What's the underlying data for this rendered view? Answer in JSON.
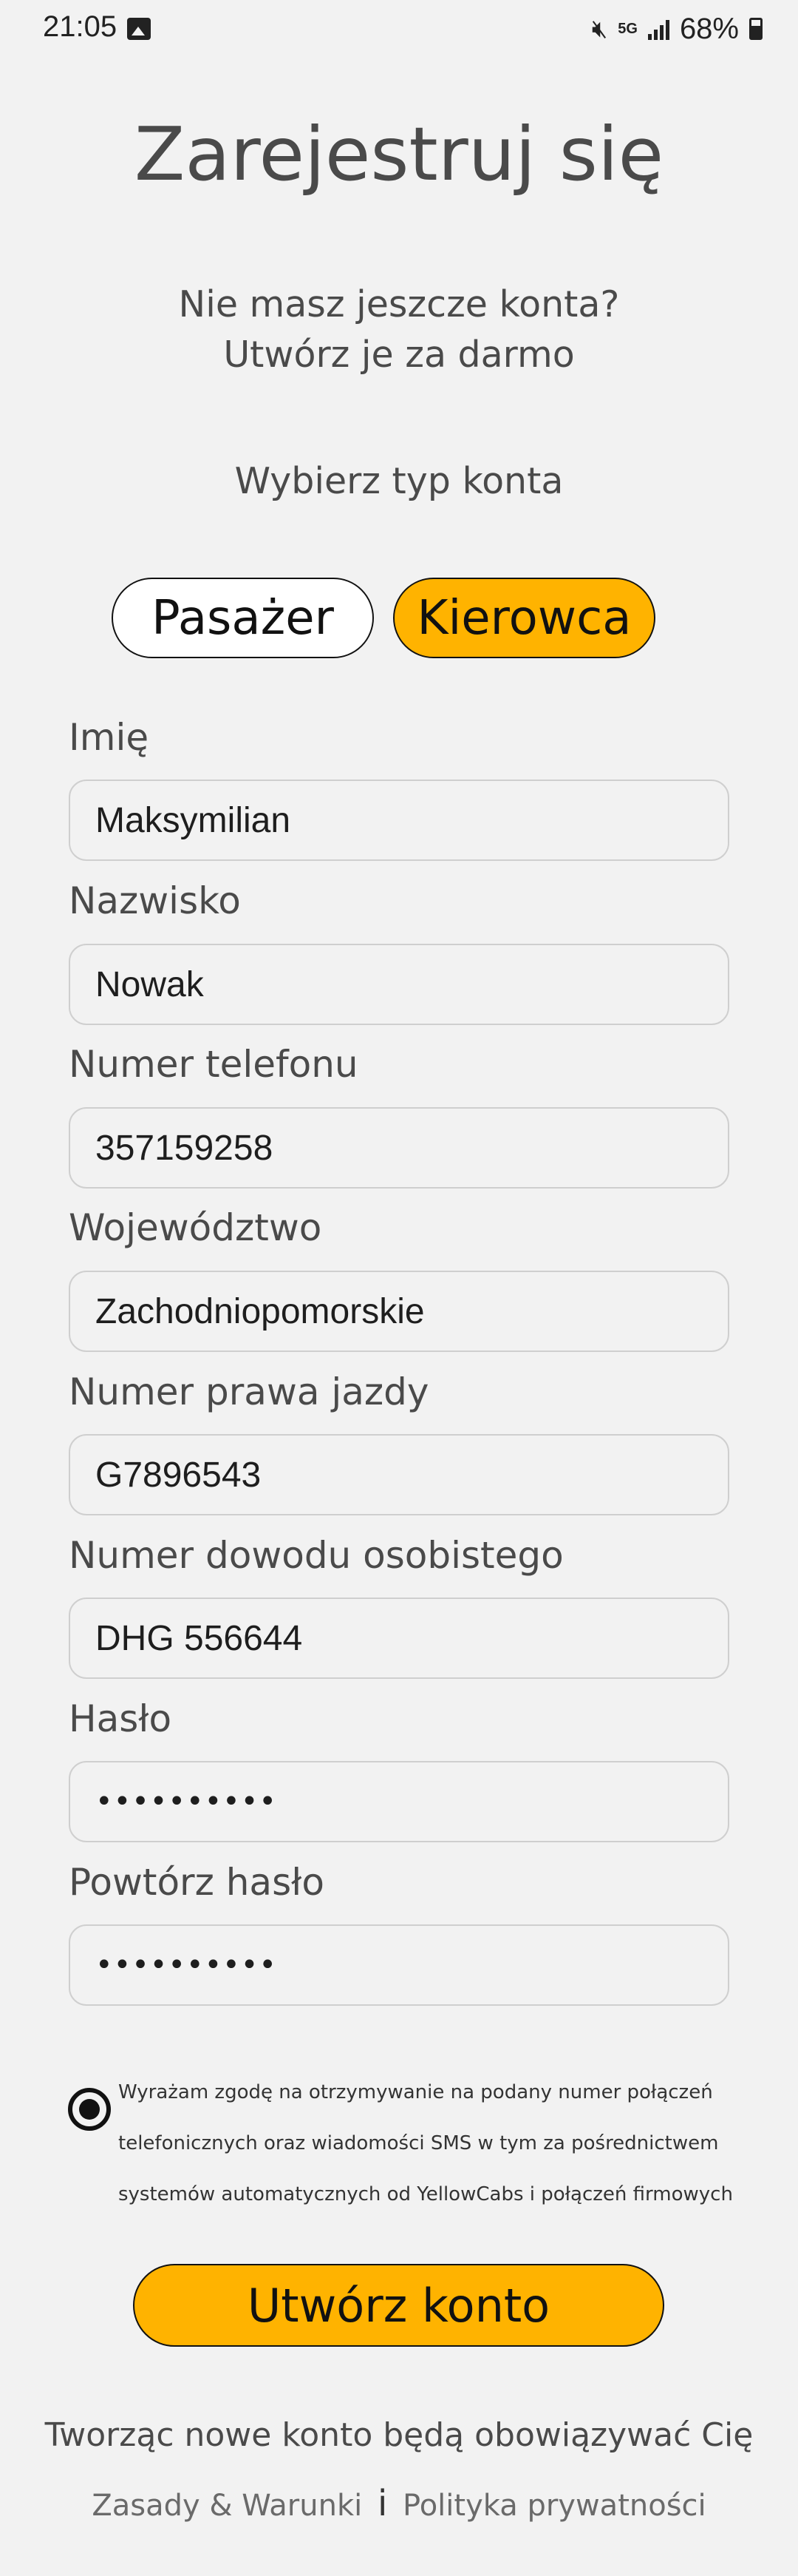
{
  "status_bar": {
    "time": "21:05",
    "network": "5G",
    "battery": "68%"
  },
  "header": {
    "title": "Zarejestruj się",
    "subtitle_line1": "Nie masz jeszcze konta?",
    "subtitle_line2": "Utwórz je za darmo",
    "choose_type": "Wybierz typ konta"
  },
  "account_types": {
    "passenger": "Pasażer",
    "driver": "Kierowca",
    "selected": "Kierowca"
  },
  "form": {
    "first_name": {
      "label": "Imię",
      "value": "Maksymilian"
    },
    "last_name": {
      "label": "Nazwisko",
      "value": "Nowak"
    },
    "phone": {
      "label": "Numer telefonu",
      "value": "357159258"
    },
    "voivodeship": {
      "label": "Województwo",
      "value": "Zachodniopomorskie"
    },
    "license": {
      "label": "Numer prawa jazdy",
      "value": "G7896543"
    },
    "id_card": {
      "label": "Numer dowodu osobistego",
      "value": "DHG 556644"
    },
    "password": {
      "label": "Hasło",
      "value": "••••••••••"
    },
    "password_repeat": {
      "label": "Powtórz hasło",
      "value": "••••••••••"
    }
  },
  "consent": {
    "line1": "Wyrażam zgodę na otrzymywanie na podany numer połączeń",
    "line2": "telefonicznych oraz wiadomości SMS w tym za pośrednictwem",
    "line3": "systemów automatycznych od YellowCabs i połączeń firmowych",
    "checked": true
  },
  "actions": {
    "create_account": "Utwórz konto"
  },
  "footer": {
    "terms_text": "Tworząc nowe konto będą obowiązywać Cię",
    "terms_link": "Zasady & Warunki",
    "separator": "i",
    "privacy_link": "Polityka prywatności"
  },
  "colors": {
    "accent": "#ffb300",
    "background": "#f2f2f2",
    "text": "#4a4a4a"
  }
}
